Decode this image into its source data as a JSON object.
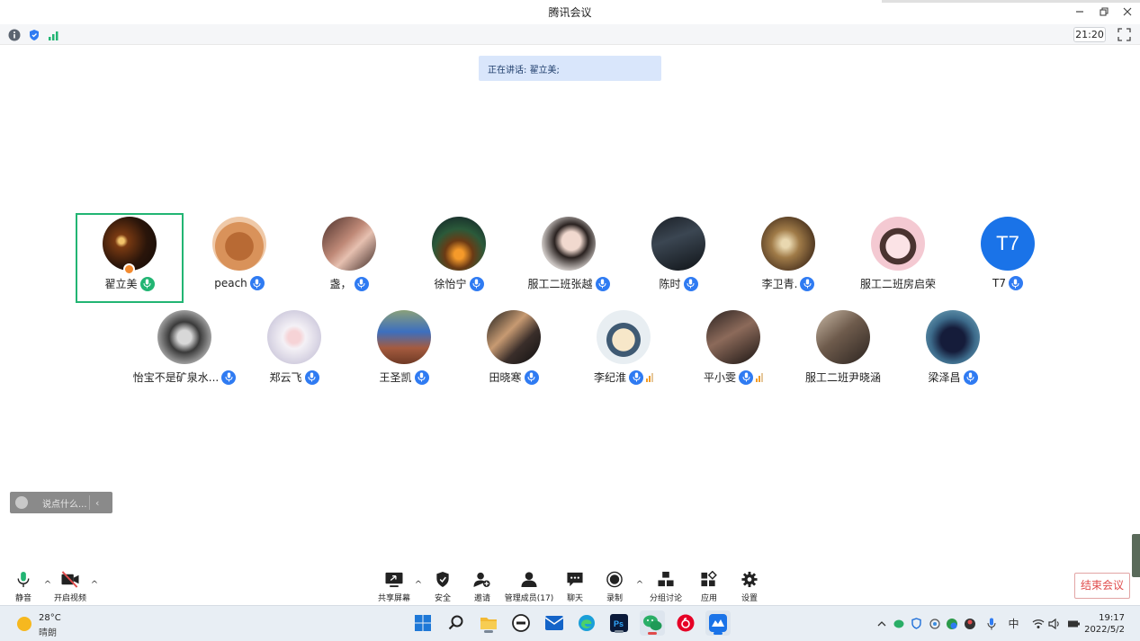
{
  "window": {
    "title": "腾讯会议",
    "time_badge": "21:20"
  },
  "speaking": {
    "label": "正在讲话:",
    "name": "翟立美;"
  },
  "participants": [
    {
      "name": "翟立美",
      "avatar": "photo-candle",
      "mic": "green",
      "host": true
    },
    {
      "name": "peach",
      "avatar": "cartoon-shooky",
      "mic": "blue"
    },
    {
      "name": "盏，",
      "avatar": "photo-girl",
      "mic": "blue"
    },
    {
      "name": "徐怡宁",
      "avatar": "photo-lights",
      "mic": "blue"
    },
    {
      "name": "服工二班张越",
      "avatar": "photo-girl-hair",
      "mic": "blue"
    },
    {
      "name": "陈时",
      "avatar": "photo-dark-room",
      "mic": "blue"
    },
    {
      "name": "李卫青.",
      "avatar": "photo-sepia",
      "mic": "blue"
    },
    {
      "name": "服工二班房启荣",
      "avatar": "cartoon-girl",
      "mic": "none"
    },
    {
      "name": "T7",
      "avatar": "initials",
      "initials": "T7",
      "mic": "blue"
    },
    {
      "name": "怡宝不是矿泉水...",
      "avatar": "photo-bw-girl",
      "mic": "blue"
    },
    {
      "name": "郑云飞",
      "avatar": "anime-white-hair",
      "mic": "blue"
    },
    {
      "name": "王圣凯",
      "avatar": "photo-blue-figure",
      "mic": "blue"
    },
    {
      "name": "田晓寒",
      "avatar": "photo-mirror",
      "mic": "blue"
    },
    {
      "name": "李纪淮",
      "avatar": "cartoon-cap",
      "mic": "blue",
      "signal": true
    },
    {
      "name": "平小雯",
      "avatar": "photo-dark-girl",
      "mic": "blue",
      "signal": true
    },
    {
      "name": "服工二班尹晓涵",
      "avatar": "photo-cat",
      "mic": "none"
    },
    {
      "name": "梁泽昌",
      "avatar": "photo-black-cat",
      "mic": "blue"
    }
  ],
  "chat": {
    "placeholder": "说点什么..."
  },
  "toolbar": {
    "mute": "静音",
    "video": "开启视频",
    "share": "共享屏幕",
    "security": "安全",
    "invite": "邀请",
    "members": "管理成员(17)",
    "chat": "聊天",
    "record": "录制",
    "breakout": "分组讨论",
    "apps": "应用",
    "settings": "设置",
    "end": "结束会议"
  },
  "taskbar": {
    "temperature": "28°C",
    "weather": "晴朗",
    "ime": "中",
    "time": "19:17",
    "date": "2022/5/2"
  },
  "colors": {
    "accent_blue": "#2f7bf2",
    "active_green": "#22b573",
    "end_red": "#e04b4b",
    "banner": "#d9e6fb"
  }
}
